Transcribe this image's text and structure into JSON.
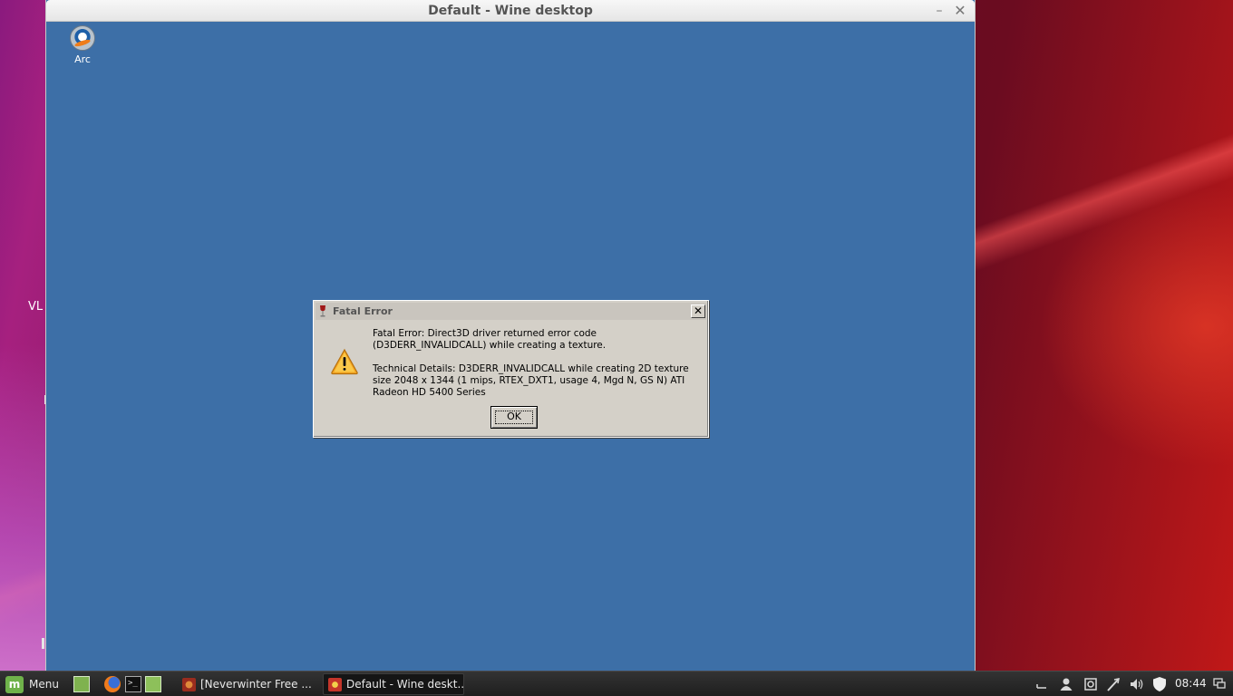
{
  "host_desktop": {
    "partial_icon_label": "VL"
  },
  "wine_window": {
    "title": "Default - Wine desktop",
    "minimize_glyph": "–",
    "close_glyph": "✕",
    "desktop_icons": [
      {
        "label": "Arc",
        "icon": "arc-icon"
      }
    ]
  },
  "error_dialog": {
    "title": "Fatal Error",
    "close_glyph": "✕",
    "icon": "warning-icon",
    "message": "Fatal Error: Direct3D driver returned error code (D3DERR_INVALIDCALL) while creating a texture.",
    "details": "Technical Details: D3DERR_INVALIDCALL while creating 2D texture size 2048 x 1344 (1 mips, RTEX_DXT1, usage 4, Mgd N, GS N) ATI Radeon HD 5400 Series",
    "ok_label": "OK"
  },
  "taskbar": {
    "menu_label": "Menu",
    "launchers": [
      "show-desktop-icon",
      "firefox-icon",
      "terminal-icon",
      "files-icon"
    ],
    "terminal_glyph": ">_",
    "tasks": [
      {
        "label": "[Neverwinter Free ...",
        "icon": "neverwinter-icon",
        "active": false
      },
      {
        "label": "Default - Wine deskt...",
        "icon": "wine-icon",
        "active": true
      }
    ],
    "tray_icons": [
      "expand-icon",
      "user-icon",
      "update-manager-icon",
      "network-icon",
      "volume-icon",
      "shield-icon"
    ],
    "clock": "08:44"
  },
  "colors": {
    "wine_desktop_bg": "#3d6fa7",
    "dialog_bg": "#d4d0c8",
    "taskbar_bg": "#2a2a2a",
    "mint_green": "#6fb24a"
  }
}
